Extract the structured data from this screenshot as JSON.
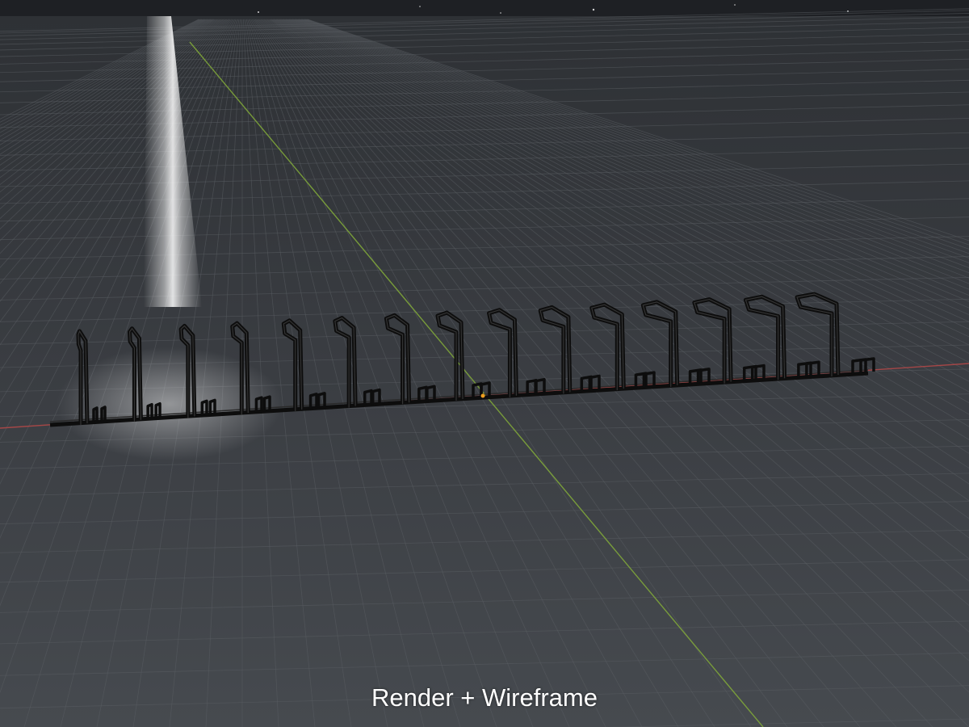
{
  "viewport": {
    "caption": "Render + Wireframe",
    "background_color": "#3a3d41",
    "sky_color": "#1e2024",
    "grid_color": "#5a5e63",
    "axis_x_color": "#b04848",
    "axis_y_color": "#7fa63a",
    "model_color": "#0d0d0d",
    "light_color": "#ffffff",
    "rack_stand_count": 15
  }
}
